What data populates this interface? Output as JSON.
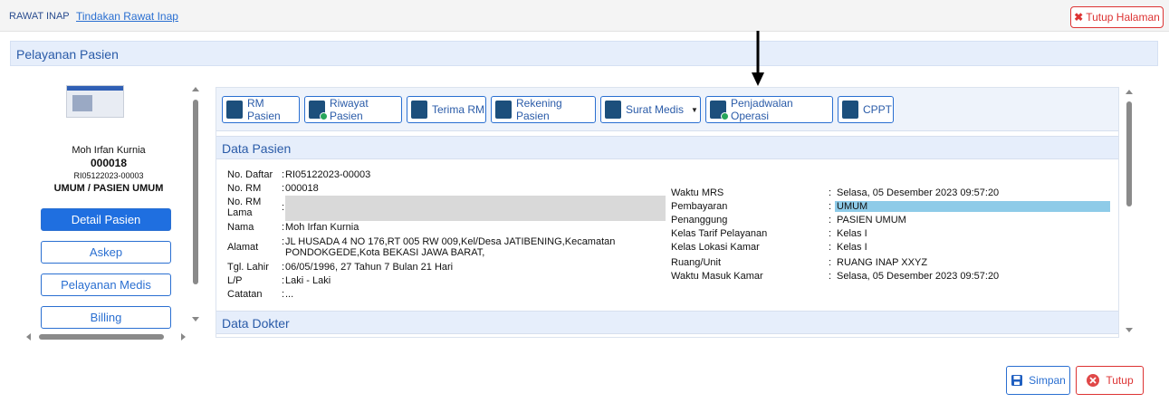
{
  "breadcrumb": {
    "root": "RAWAT INAP",
    "current": "Tindakan Rawat Inap"
  },
  "close_page_label": "Tutup Halaman",
  "panel_title": "Pelayanan Pasien",
  "patient": {
    "name": "Moh Irfan Kurnia",
    "rm_number": "000018",
    "reg_number": "RI05122023-00003",
    "class": "UMUM / PASIEN UMUM"
  },
  "nav": [
    {
      "label": "Detail Pasien"
    },
    {
      "label": "Askep"
    },
    {
      "label": "Pelayanan Medis"
    },
    {
      "label": "Billing"
    }
  ],
  "toolbar": [
    {
      "label": "RM Pasien",
      "icon": "document-icon"
    },
    {
      "label": "Riwayat Pasien",
      "icon": "document-clock-icon"
    },
    {
      "label": "Terima RM",
      "icon": "inbox-plus-icon"
    },
    {
      "label": "Rekening Pasien",
      "icon": "card-icon"
    },
    {
      "label": "Surat Medis",
      "icon": "document-plus-icon"
    },
    {
      "label": "Penjadwalan Operasi",
      "icon": "document-clock-icon"
    },
    {
      "label": "CPPT",
      "icon": "list-icon"
    }
  ],
  "data_pasien": {
    "title": "Data Pasien",
    "left": [
      {
        "label": "No. Daftar",
        "value": "RI05122023-00003"
      },
      {
        "label": "No. RM",
        "value": "000018"
      },
      {
        "label": "No. RM Lama",
        "value": ""
      },
      {
        "label": "Nama",
        "value": "Moh Irfan Kurnia"
      },
      {
        "label": "Alamat",
        "value": "JL HUSADA 4 NO 176,RT 005 RW 009,Kel/Desa JATIBENING,Kecamatan PONDOKGEDE,Kota BEKASI JAWA BARAT,"
      },
      {
        "label": "Tgl. Lahir",
        "value": "06/05/1996, 27 Tahun 7 Bulan 21 Hari"
      },
      {
        "label": "L/P",
        "value": "Laki - Laki"
      },
      {
        "label": "Catatan",
        "value": "..."
      }
    ],
    "right": [
      {
        "label": "Waktu MRS",
        "value": "Selasa, 05 Desember 2023 09:57:20"
      },
      {
        "label": "Pembayaran",
        "value": "UMUM"
      },
      {
        "label": "Penanggung",
        "value": "PASIEN UMUM"
      },
      {
        "label": "Kelas Tarif Pelayanan",
        "value": "Kelas I"
      },
      {
        "label": "Kelas Lokasi Kamar",
        "value": "Kelas I"
      },
      {
        "label": "Ruang/Unit",
        "value": "RUANG INAP XXYZ"
      },
      {
        "label": "Waktu Masuk Kamar",
        "value": "Selasa, 05 Desember 2023 09:57:20"
      }
    ]
  },
  "data_dokter": {
    "title": "Data Dokter"
  },
  "footer": {
    "save_label": "Simpan",
    "close_label": "Tutup"
  },
  "colors": {
    "accent": "#2a6fd1",
    "danger": "#dd3333",
    "highlight": "#8ecbe8"
  }
}
